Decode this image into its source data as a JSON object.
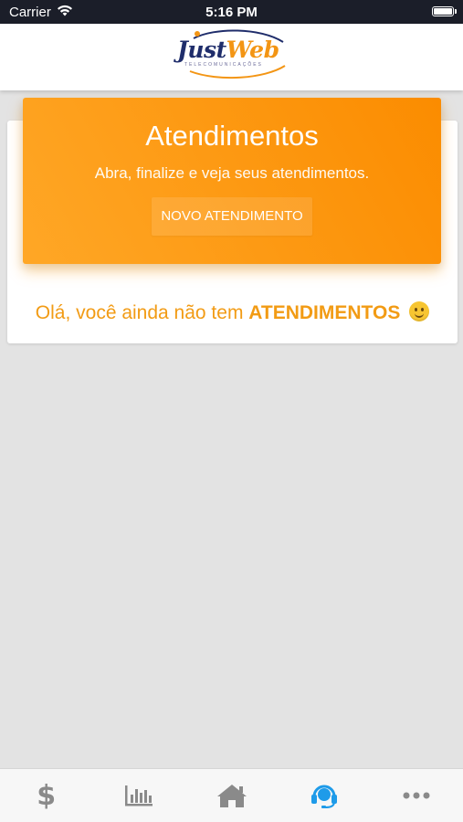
{
  "status_bar": {
    "carrier": "Carrier",
    "time": "5:16 PM",
    "icons": [
      "wifi-icon",
      "battery-icon"
    ]
  },
  "header": {
    "logo_primary": "Just",
    "logo_accent": "Web",
    "logo_sub": "TELECOMUNICAÇÕES"
  },
  "banner": {
    "title": "Atendimentos",
    "subtitle": "Abra, finalize e veja seus atendimentos.",
    "button_label": "NOVO ATENDIMENTO"
  },
  "empty_state": {
    "text": "Olá, você ainda não tem",
    "emphasis": "ATENDIMENTOS"
  },
  "tab_bar": {
    "items": [
      {
        "icon": "dollar-icon",
        "glyph": "$",
        "active": false
      },
      {
        "icon": "chart-icon",
        "active": false
      },
      {
        "icon": "home-icon",
        "active": false
      },
      {
        "icon": "headset-icon",
        "active": true
      },
      {
        "icon": "more-icon",
        "active": false
      }
    ]
  },
  "colors": {
    "status_bar_bg": "#1b1e29",
    "accent_orange": "#fb8c00",
    "banner_gradient_start": "#ffa726",
    "message_orange": "#f29b14",
    "tab_inactive": "#8a8a8a",
    "tab_active": "#1e9be9",
    "background": "#e3e3e3"
  }
}
